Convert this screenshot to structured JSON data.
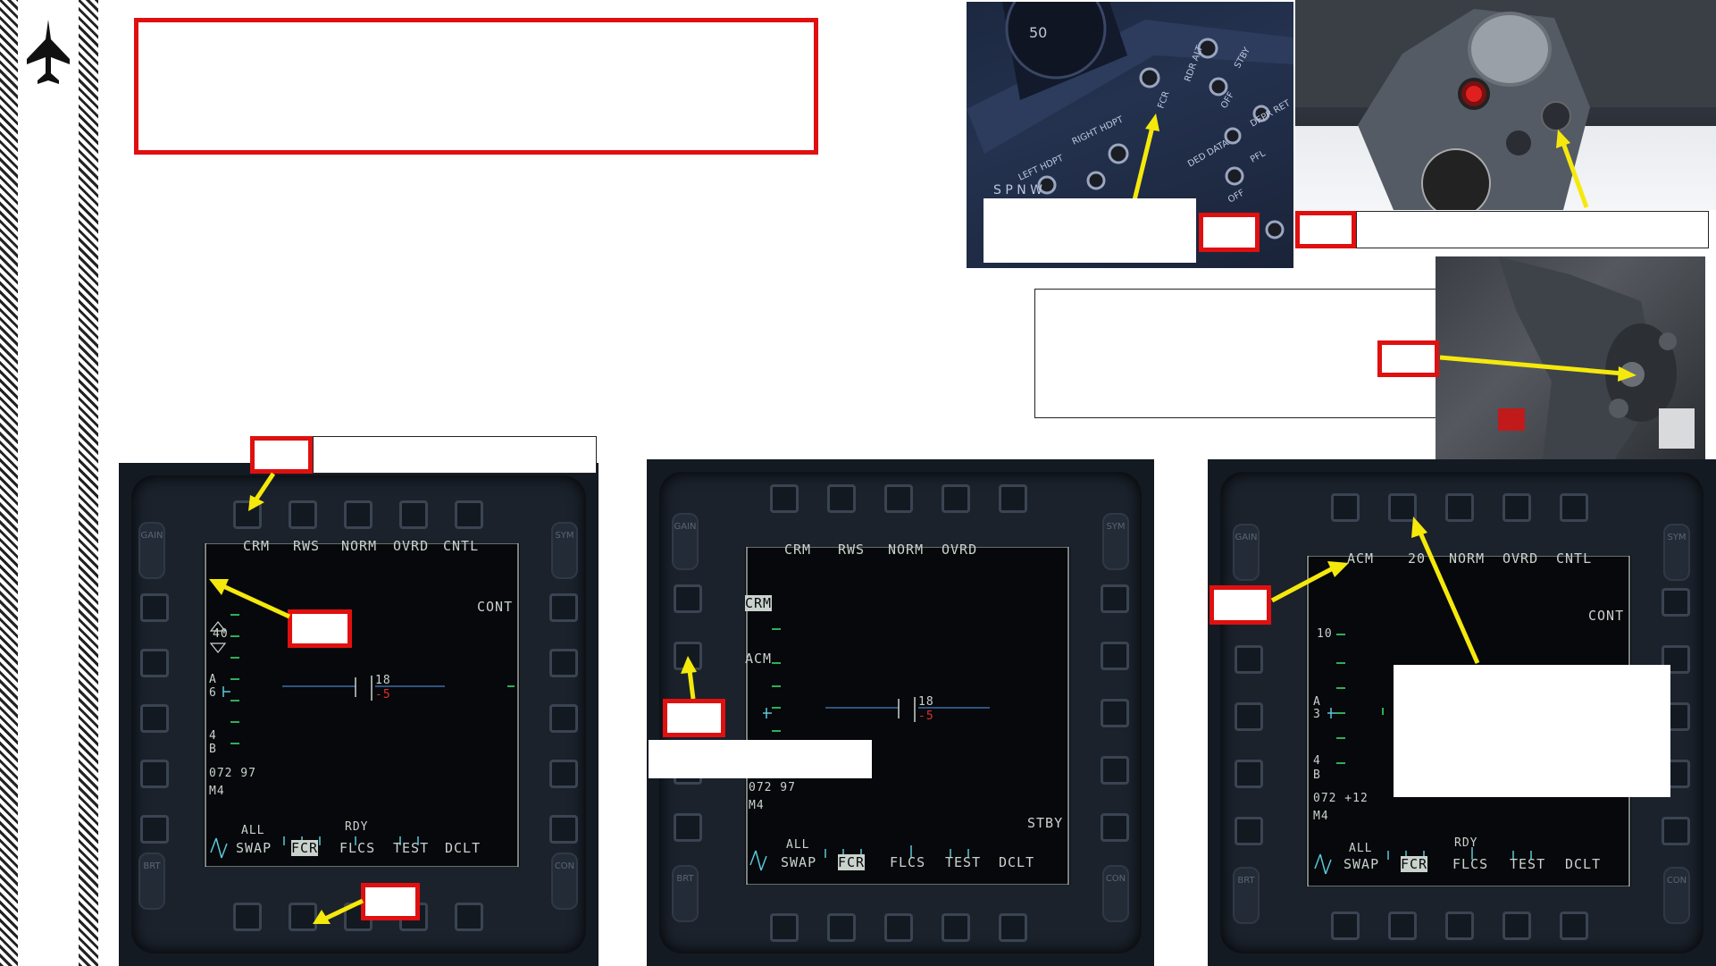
{
  "sidebar": {
    "icon": "jet-icon"
  },
  "title_box": {
    "text": ""
  },
  "mfd1": {
    "top_labels": [
      "CRM",
      "RWS",
      "NORM",
      "OVRD",
      "CNTL"
    ],
    "right_label": "CONT",
    "range": "40",
    "az_a": "A",
    "az_6": "6",
    "bars": "4",
    "bars_b": "B",
    "readout1": "072 97",
    "readout2": "M4",
    "scale_top": "18",
    "scale_bot": "-5",
    "bottom_all": "ALL",
    "bottom_rdy": "RDY",
    "bottom_labels": [
      "SWAP",
      "FCR",
      "FLCS",
      "TEST",
      "DCLT"
    ],
    "rocker_gain": "GAIN",
    "rocker_sym": "SYM",
    "rocker_brt": "BRT",
    "rocker_con": "CON"
  },
  "mfd2": {
    "top_labels": [
      "CRM",
      "RWS",
      "NORM",
      "OVRD"
    ],
    "menu_crm": "CRM",
    "menu_acm": "ACM",
    "readout1": "072 97",
    "readout2": "M4",
    "scale_top": "18",
    "scale_bot": "-5",
    "stby": "STBY",
    "bottom_all": "ALL",
    "bottom_labels": [
      "SWAP",
      "FCR",
      "FLCS",
      "TEST",
      "DCLT"
    ],
    "rocker_gain": "GAIN",
    "rocker_sym": "SYM",
    "rocker_brt": "BRT",
    "rocker_con": "CON"
  },
  "mfd3": {
    "top_labels": [
      "ACM",
      "20",
      "NORM",
      "OVRD",
      "CNTL"
    ],
    "right_label": "CONT",
    "range": "10",
    "az_a": "A",
    "az_3": "3",
    "bars": "4",
    "bars_b": "B",
    "readout1": "072 +12",
    "readout2": "M4",
    "bottom_all": "ALL",
    "bottom_rdy": "RDY",
    "bottom_labels": [
      "SWAP",
      "FCR",
      "FLCS",
      "TEST",
      "DCLT"
    ],
    "rocker_gain": "GAIN",
    "rocker_sym": "SYM",
    "rocker_brt": "BRT",
    "rocker_con": "CON"
  },
  "panel_photo": {
    "labels": [
      "50",
      "RIGHT HDPT",
      "LEFT HDPT",
      "FCR",
      "RDR ALT",
      "STBY",
      "OFF",
      "DED DATA",
      "DEPR RET",
      "PFL",
      "S P N W",
      "OFF"
    ]
  },
  "colors": {
    "callout_red": "#e01010",
    "arrow_yellow": "#f5e90c",
    "mfd_text": "#c9d3cc",
    "mfd_cyan": "#5bc8d8"
  }
}
